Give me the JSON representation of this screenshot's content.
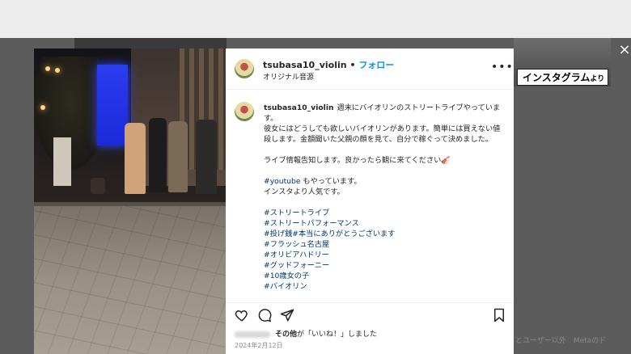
{
  "post": {
    "username": "tsubasa10_violin",
    "separator": "•",
    "follow_label": "フォロー",
    "audio_label": "オリジナル音源",
    "more_label": "•••",
    "caption": {
      "username": "tsubasa10_violin",
      "line1": "週末にバイオリンのストリートライブやっています。",
      "line2": "彼女にはどうしても欲しいバイオリンがあります。簡単には買えない値段します。金額聞いた父親の顔を見て、自分で稼ぐって決めました。",
      "line3": "ライブ情報告知します。良かったら観に来てください🎻",
      "youtube_tag": "#youtube",
      "line4": "もやっています。",
      "line5": "インスタより人気です。",
      "hashtags": [
        "#ストリートライブ",
        "#ストリートパフォーマンス",
        "#投げ銭#本当にありがとうございます",
        "#フラッシュ名古屋",
        "#オリビアハドリー",
        "#グッドフォーニー",
        "#10歳女の子",
        "#バイオリン"
      ]
    },
    "likes_text_bold": "その他",
    "likes_text": "が「いいね！」しました",
    "date": "2024年2月12日"
  },
  "overlay": {
    "close_label": "×",
    "source_badge": "インスタグラム",
    "source_badge_suffix": "より",
    "footer_text": "ドとユーザー以外　Metaのド"
  },
  "icons": {
    "like": "heart-icon",
    "comment": "comment-icon",
    "share": "send-icon",
    "save": "bookmark-icon",
    "more": "more-horizontal-icon",
    "close": "close-icon"
  },
  "colors": {
    "link_blue": "#0095f6",
    "hashtag": "#00376b",
    "overlay": "#5c5c5c"
  }
}
